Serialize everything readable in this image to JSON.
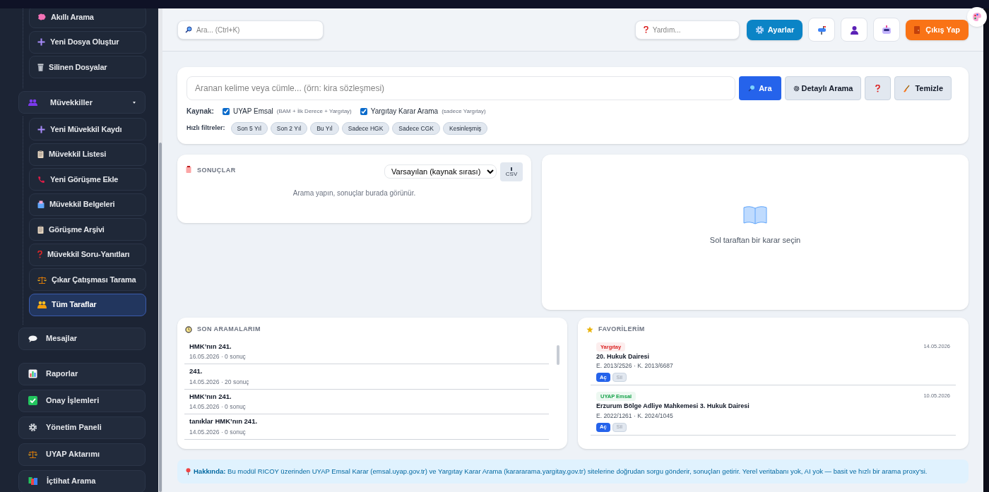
{
  "sidebar": {
    "items": [
      {
        "kind": "sub",
        "label": "Akıllı Arama",
        "selected": false
      },
      {
        "kind": "sub",
        "label": "Yeni Dosya Oluştur",
        "selected": false
      },
      {
        "kind": "sub",
        "label": "Silinen Dosyalar",
        "selected": false
      },
      {
        "kind": "group",
        "label": "Müvekkiller",
        "selected": false,
        "expanded": true,
        "children": [
          {
            "label": "Yeni Müvekkil Kaydı",
            "selected": false
          },
          {
            "label": "Müvekkil Listesi",
            "selected": false
          },
          {
            "label": "Yeni Görüşme Ekle",
            "selected": false
          },
          {
            "label": "Müvekkil Belgeleri",
            "selected": false
          },
          {
            "label": "Görüşme Arşivi",
            "selected": false
          },
          {
            "label": "Müvekkil Soru-Yanıtları",
            "selected": false
          },
          {
            "label": "Çıkar Çatışması Tarama",
            "selected": false
          },
          {
            "label": "Tüm Taraflar",
            "selected": true
          }
        ]
      },
      {
        "kind": "link",
        "label": "Mesajlar",
        "selected": false
      },
      {
        "kind": "link",
        "label": "Raporlar",
        "selected": false
      },
      {
        "kind": "link",
        "label": "Onay İşlemleri",
        "selected": false
      },
      {
        "kind": "link",
        "label": "Yönetim Paneli",
        "selected": false
      },
      {
        "kind": "link",
        "label": "UYAP Aktarımı",
        "selected": false
      },
      {
        "kind": "link",
        "label": "İçtihat Arama",
        "selected": false
      }
    ]
  },
  "header": {
    "search": {
      "placeholder": "Ara... (Ctrl+K)"
    },
    "help": {
      "placeholder": "Yardım..."
    },
    "settings_button": "Ayarlar",
    "logout_button": "Çıkış Yap"
  },
  "search_panel": {
    "placeholder": "Aranan kelime veya cümle... (örn: kira sözleşmesi)",
    "buttons": [
      {
        "kind": "primary",
        "label": "Ara"
      },
      {
        "kind": "secondary",
        "label": "Detaylı Arama"
      },
      {
        "kind": "help"
      },
      {
        "kind": "clear",
        "label": "Temizle"
      }
    ],
    "sources_label": "Kaynak:",
    "sources": [
      {
        "label": "UYAP Emsal",
        "note": "(BAM + İlk Derece + Yargıtay)",
        "checked": true
      },
      {
        "label": "Yargıtay Karar Arama",
        "note": "(sadece Yargıtay)",
        "checked": true
      }
    ],
    "filters_label": "Hızlı filtreler:",
    "filters": [
      "Son 5 Yıl",
      "Son 2 Yıl",
      "Bu Yıl",
      "Sadece HGK",
      "Sadece CGK",
      "Kesinleşmiş"
    ]
  },
  "results": {
    "title": "SONUÇLAR",
    "sort": "Varsayılan (kaynak sırası)",
    "csv_button": "CSV",
    "empty": "Arama yapın, sonuçlar burada görünür."
  },
  "detail": {
    "empty": "Sol taraftan bir karar seçin"
  },
  "recent": {
    "title": "SON ARAMALARIM",
    "items": [
      {
        "query": "HMK’nın 241.",
        "meta": "16.05.2026 · 0 sonuç"
      },
      {
        "query": "241.",
        "meta": "14.05.2026 · 20 sonuç"
      },
      {
        "query": "HMK’nın 241.",
        "meta": "14.05.2026 · 0 sonuç"
      },
      {
        "query": "tanıklar HMK’nın 241.",
        "meta": "14.05.2026 · 0 sonuç"
      }
    ]
  },
  "favorites": {
    "title": "FAVORİLERİM",
    "items": [
      {
        "source": "Yargıtay",
        "color": "#dc2626",
        "date": "14.05.2026",
        "court": "20. Hukuk Dairesi",
        "numbers": "E. 2013/2526 · K. 2013/6687",
        "open_button": "Aç",
        "delete_button": "Sil"
      },
      {
        "source": "UYAP Emsal",
        "color": "#16a34a",
        "date": "10.05.2026",
        "court": "Erzurum Bölge Adliye Mahkemesi 3. Hukuk Dairesi",
        "numbers": "E. 2022/1261 · K. 2024/1045",
        "open_button": "Aç",
        "delete_button": "Sil"
      }
    ]
  },
  "info": {
    "text": "**Hakkında:** Bu modül RICOY üzerinden UYAP Emsal Karar (emsal.uyap.gov.tr) ve Yargıtay Karar Arama (karararama.yargitay.gov.tr) sitelerine doğrudan sorgu gönderir, sonuçları getirir. Yerel veritabanı yok, AI yok — basit ve hızlı bir arama proxy'si."
  }
}
